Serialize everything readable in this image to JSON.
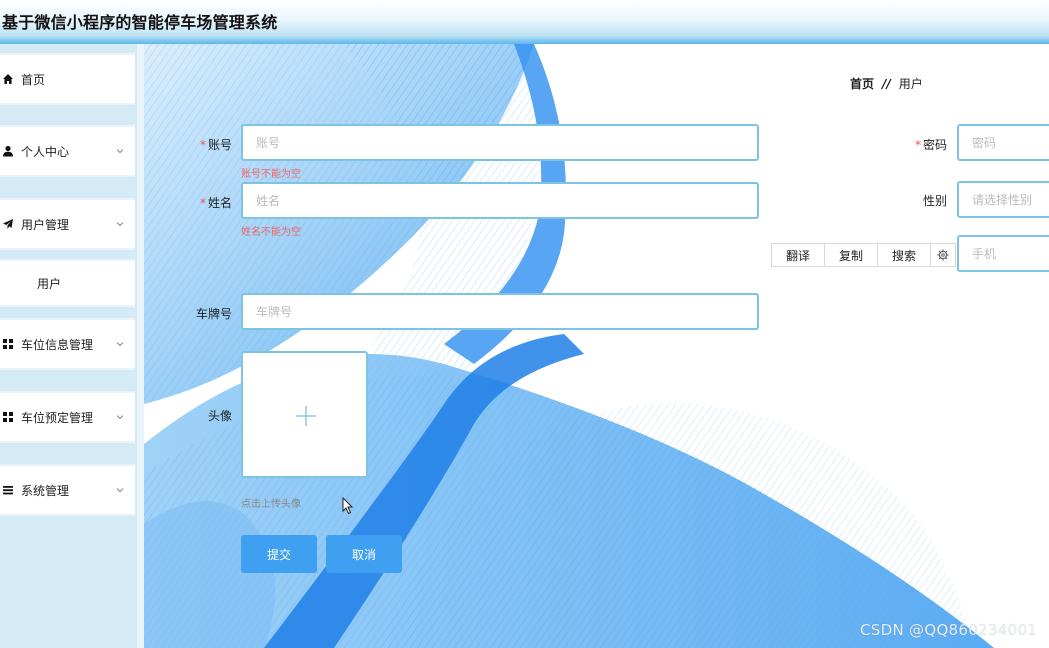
{
  "app": {
    "title": "基于微信小程序的智能停车场管理系统"
  },
  "sidebar": {
    "items": [
      {
        "label": "首页",
        "icon": "home-icon"
      },
      {
        "label": "个人中心",
        "icon": "person-icon",
        "expandable": true
      },
      {
        "label": "用户管理",
        "icon": "send-icon",
        "expandable": true
      },
      {
        "label": "用户",
        "submenu": true
      },
      {
        "label": "车位信息管理",
        "icon": "grid-icon",
        "expandable": true
      },
      {
        "label": "车位预定管理",
        "icon": "grid-icon",
        "expandable": true
      },
      {
        "label": "系统管理",
        "icon": "list-icon",
        "expandable": true
      }
    ]
  },
  "breadcrumb": {
    "home": "首页",
    "separator": "//",
    "current": "用户"
  },
  "form": {
    "account": {
      "label": "账号",
      "placeholder": "账号",
      "value": "",
      "required": true,
      "error": "账号不能为空"
    },
    "password": {
      "label": "密码",
      "placeholder": "密码",
      "value": "",
      "required": true
    },
    "name": {
      "label": "姓名",
      "placeholder": "姓名",
      "value": "",
      "required": true,
      "error": "姓名不能为空"
    },
    "gender": {
      "label": "性别",
      "placeholder": "请选择性别",
      "value": ""
    },
    "phone": {
      "placeholder": "手机",
      "value": ""
    },
    "plate": {
      "label": "车牌号",
      "placeholder": "车牌号",
      "value": ""
    },
    "avatar": {
      "label": "头像",
      "hint": "点击上传头像"
    },
    "submit_label": "提交",
    "cancel_label": "取消"
  },
  "translate_popup": {
    "translate": "翻译",
    "copy": "复制",
    "search": "搜索",
    "settings_icon": "gear-icon"
  },
  "watermark": "CSDN @QQ860234001",
  "colors": {
    "accent": "#3fa0f2",
    "field_border": "#7fc3e2",
    "error": "#e66666",
    "sidebar_bg": "#d4eaf4"
  }
}
